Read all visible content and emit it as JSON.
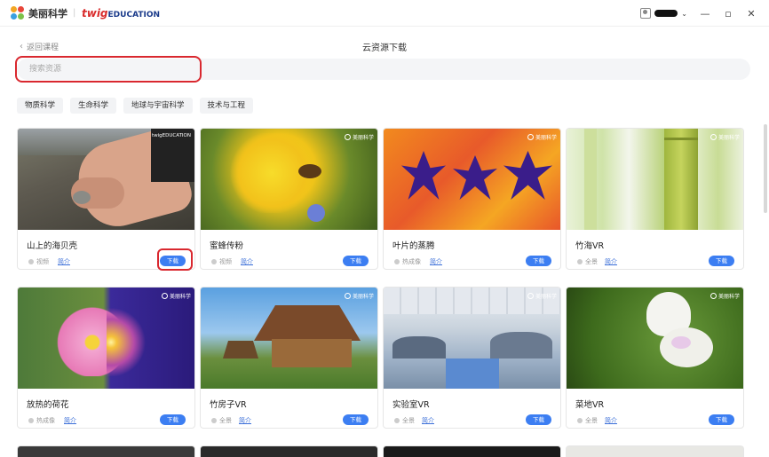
{
  "titlebar": {
    "app_name": "美丽科学",
    "partner_twig": "twig",
    "partner_edu": "EDUCATION",
    "separator": "|",
    "minimize": "—",
    "maximize": "▫",
    "close": "✕"
  },
  "header": {
    "back_label": "返回课程",
    "title": "云资源下载"
  },
  "search": {
    "placeholder": "搜索资源",
    "value": ""
  },
  "categories": [
    "物质科学",
    "生命科学",
    "地球与宇宙科学",
    "技术与工程"
  ],
  "cards": [
    {
      "title": "山上的海贝壳",
      "tag": "视频",
      "intro": "简介",
      "download": "下载",
      "brand": "twigEDUCATION"
    },
    {
      "title": "蜜蜂传粉",
      "tag": "视频",
      "intro": "简介",
      "download": "下载",
      "brand": "美丽科学"
    },
    {
      "title": "叶片的蒸腾",
      "tag": "热成像",
      "intro": "简介",
      "download": "下载",
      "brand": "美丽科学"
    },
    {
      "title": "竹海VR",
      "tag": "全景",
      "intro": "简介",
      "download": "下载",
      "brand": "美丽科学"
    },
    {
      "title": "放热的荷花",
      "tag": "热成像",
      "intro": "简介",
      "download": "下载",
      "brand": "美丽科学"
    },
    {
      "title": "竹房子VR",
      "tag": "全景",
      "intro": "简介",
      "download": "下载",
      "brand": "美丽科学"
    },
    {
      "title": "实验室VR",
      "tag": "全景",
      "intro": "简介",
      "download": "下载",
      "brand": "美丽科学"
    },
    {
      "title": "菜地VR",
      "tag": "全景",
      "intro": "简介",
      "download": "下载",
      "brand": "美丽科学"
    }
  ],
  "colors": {
    "accent": "#3c7ef2",
    "highlight": "#d9282f",
    "link": "#3b6fd8"
  }
}
